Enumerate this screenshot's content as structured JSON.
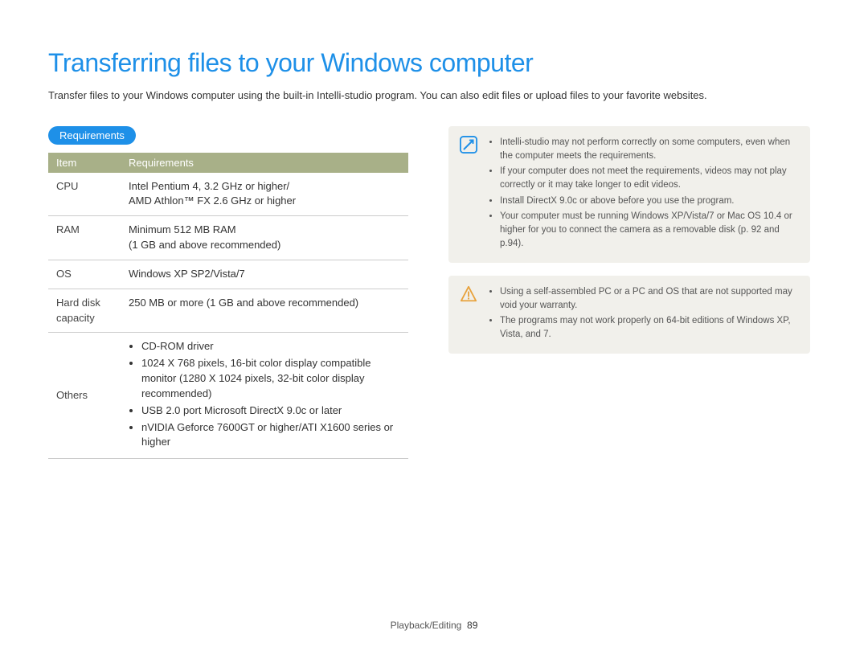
{
  "heading": "Transferring files to your Windows computer",
  "intro": "Transfer files to your Windows computer using the built-in Intelli-studio program. You can also edit files or upload files to your favorite websites.",
  "sectionLabel": "Requirements",
  "table": {
    "headers": {
      "item": "Item",
      "req": "Requirements"
    },
    "rows": {
      "cpu": {
        "item": "CPU",
        "req": "Intel Pentium 4, 3.2 GHz or higher/\nAMD Athlon™ FX 2.6 GHz or higher"
      },
      "ram": {
        "item": "RAM",
        "req": "Minimum 512 MB RAM\n(1 GB and above recommended)"
      },
      "os": {
        "item": "OS",
        "req": "Windows XP SP2/Vista/7"
      },
      "hdd": {
        "item": "Hard disk capacity",
        "req": "250 MB or more (1 GB and above recommended)"
      },
      "others": {
        "item": "Others",
        "bullets": [
          "CD-ROM driver",
          "1024 X 768 pixels, 16-bit color display compatible monitor (1280 X 1024 pixels, 32-bit color display recommended)",
          "USB 2.0 port Microsoft DirectX 9.0c or later",
          "nVIDIA Geforce 7600GT or higher/ATI X1600 series or higher"
        ]
      }
    }
  },
  "infoNotes": [
    "Intelli-studio may not perform correctly on some computers, even when the computer meets the requirements.",
    "If your computer does not meet the requirements, videos may not play correctly or it may take longer to edit videos.",
    "Install DirectX 9.0c or above before you use the program.",
    "Your computer must be running Windows XP/Vista/7 or Mac OS 10.4 or higher for you to connect the camera as a removable disk (p. 92 and p.94)."
  ],
  "warnNotes": [
    "Using a self-assembled PC or a PC and OS that are not supported may void your warranty.",
    "The programs may not work properly on 64-bit editions of Windows XP, Vista, and 7."
  ],
  "footer": {
    "section": "Playback/Editing",
    "page": "89"
  }
}
